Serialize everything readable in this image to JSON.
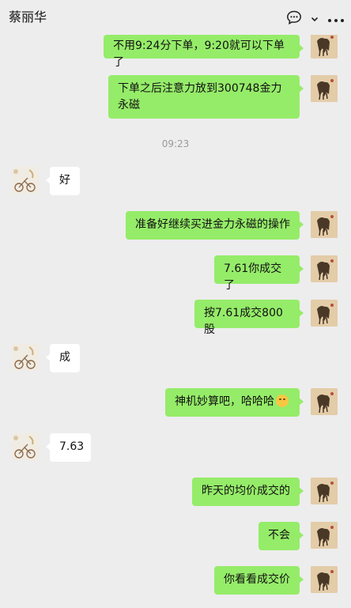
{
  "header": {
    "title": "蔡丽华",
    "icons": [
      "chat-bubble-icon",
      "chevron-down-icon",
      "more-icon"
    ]
  },
  "messages": [
    {
      "side": "me",
      "text": "不用9:24分下单，9:20就可以下单了"
    },
    {
      "side": "me",
      "text": "下单之后注意力放到300748金力永磁"
    },
    {
      "side": "time",
      "text": "09:23"
    },
    {
      "side": "other",
      "text": "好"
    },
    {
      "side": "me",
      "text": "准备好继续买进金力永磁的操作"
    },
    {
      "side": "me",
      "text": "7.61你成交了"
    },
    {
      "side": "me",
      "text": "按7.61成交800股"
    },
    {
      "side": "other",
      "text": "成"
    },
    {
      "side": "me",
      "text": "神机妙算吧，哈哈哈",
      "emoji": "smirk-emoji"
    },
    {
      "side": "other",
      "text": "7.63"
    },
    {
      "side": "me",
      "text": "昨天的均价成交的"
    },
    {
      "side": "me",
      "text": "不会"
    },
    {
      "side": "me",
      "text": "你看看成交价"
    }
  ]
}
